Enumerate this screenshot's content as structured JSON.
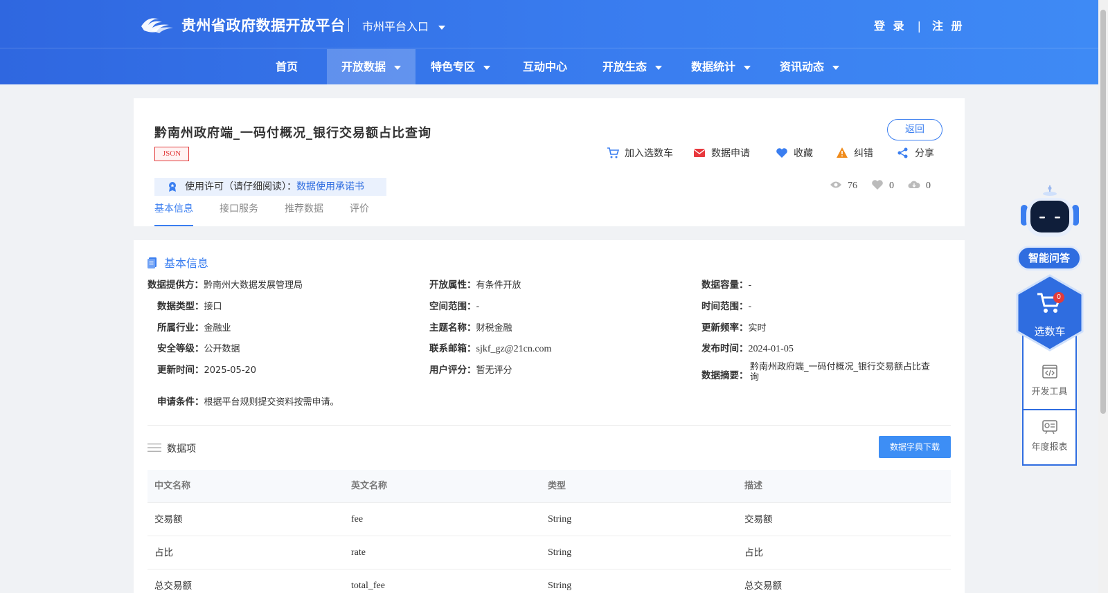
{
  "header": {
    "site_title": "贵州省政府数据开放平台",
    "city_entry": "市州平台入口",
    "login": "登 录",
    "separator": "|",
    "register": "注 册"
  },
  "nav": [
    {
      "label": "首页",
      "has_dropdown": false
    },
    {
      "label": "开放数据",
      "has_dropdown": true,
      "active": true
    },
    {
      "label": "特色专区",
      "has_dropdown": true
    },
    {
      "label": "互动中心",
      "has_dropdown": false
    },
    {
      "label": "开放生态",
      "has_dropdown": true
    },
    {
      "label": "数据统计",
      "has_dropdown": true
    },
    {
      "label": "资讯动态",
      "has_dropdown": true
    }
  ],
  "dataset": {
    "title": "黔南州政府端_一码付概况_银行交易额占比查询",
    "format_tag": "JSON",
    "back_button": "返回",
    "actions": [
      {
        "label": "加入选数车",
        "icon": "cart-icon"
      },
      {
        "label": "数据申请",
        "icon": "mail-icon"
      },
      {
        "label": "收藏",
        "icon": "heart-icon"
      },
      {
        "label": "纠错",
        "icon": "warning-icon"
      },
      {
        "label": "分享",
        "icon": "share-icon"
      }
    ],
    "license_prefix": "使用许可（请仔细阅读）：",
    "license_link": "数据使用承诺书",
    "stats": {
      "views": "76",
      "likes": "0",
      "downloads": "0"
    },
    "tabs": [
      "基本信息",
      "接口服务",
      "推荐数据",
      "评价"
    ]
  },
  "basic_info": {
    "section_title": "基本信息",
    "fields": {
      "provider": {
        "k": "数据提供方：",
        "v": "黔南州大数据发展管理局"
      },
      "open_attr": {
        "k": "开放属性：",
        "v": "有条件开放"
      },
      "capacity": {
        "k": "数据容量：",
        "v": "-"
      },
      "data_type": {
        "k": "数据类型：",
        "v": "接口"
      },
      "spatial": {
        "k": "空间范围：",
        "v": "-"
      },
      "time_range": {
        "k": "时间范围：",
        "v": "-"
      },
      "industry": {
        "k": "所属行业：",
        "v": "金融业"
      },
      "theme": {
        "k": "主题名称：",
        "v": "财税金融"
      },
      "frequency": {
        "k": "更新频率：",
        "v": "实时"
      },
      "security": {
        "k": "安全等级：",
        "v": "公开数据"
      },
      "email": {
        "k": "联系邮箱：",
        "v": "sjkf_gz@21cn.com"
      },
      "publish_time": {
        "k": "发布时间：",
        "v": "2024-01-05"
      },
      "update_time": {
        "k": "更新时间：",
        "v": "2025-05-20"
      },
      "rating": {
        "k": "用户评分：",
        "v": "暂无评分"
      },
      "summary": {
        "k": "数据摘要：",
        "v1": "黔南州政府端_一码付概况_银行交易额占比查",
        "v2": "询"
      },
      "condition": {
        "k": "申请条件：",
        "v": "根据平台规则提交资料按需申请。"
      }
    }
  },
  "data_items": {
    "title": "数据项",
    "download_button": "数据字典下载",
    "columns": [
      "中文名称",
      "英文名称",
      "类型",
      "描述"
    ],
    "rows": [
      [
        "交易额",
        "fee",
        "String",
        "交易额"
      ],
      [
        "占比",
        "rate",
        "String",
        "占比"
      ],
      [
        "总交易额",
        "total_fee",
        "String",
        "总交易额"
      ]
    ]
  },
  "side_widget": {
    "qa_label": "智能问答",
    "cart_label": "选数车",
    "cart_count": "0",
    "tools": [
      "开发工具",
      "年度报表"
    ]
  },
  "colors": {
    "primary": "#3a7ef0",
    "header_gradient_start": "#2f67e0",
    "header_gradient_end": "#3e8af5",
    "tag_red": "#e23b3b",
    "download_button": "#3d8ef5"
  }
}
